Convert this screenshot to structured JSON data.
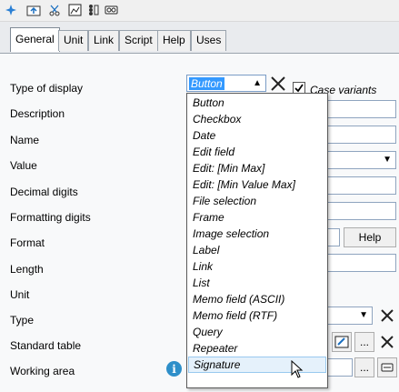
{
  "tabs": [
    "General",
    "Unit",
    "Link",
    "Script",
    "Help",
    "Uses"
  ],
  "labels": {
    "type_of_display": "Type of display",
    "description": "Description",
    "name": "Name",
    "value": "Value",
    "decimal_digits": "Decimal digits",
    "formatting_digits": "Formatting digits",
    "format": "Format",
    "length": "Length",
    "unit": "Unit",
    "type": "Type",
    "standard_table": "Standard table",
    "working_area": "Working area"
  },
  "type_of_display_value": "Button",
  "case_variants": {
    "label": "Case variants",
    "checked": true
  },
  "help_button": "Help",
  "ellipsis": "...",
  "info_glyph": "i",
  "display_options": [
    "Button",
    "Checkbox",
    "Date",
    "Edit field",
    "Edit: [Min Max]",
    "Edit: [Min Value Max]",
    "File selection",
    "Frame",
    "Image selection",
    "Label",
    "Link",
    "List",
    "Memo field (ASCII)",
    "Memo field (RTF)",
    "Query",
    "Repeater",
    "Signature"
  ],
  "hovered_option": "Signature",
  "icons": [
    "star-icon",
    "folder-upload-icon",
    "cut-icon",
    "image-edit-icon",
    "list-icon",
    "tape-icon",
    "close-icon",
    "dropdown-arrow-icon",
    "edit-icon",
    "info-icon",
    "mouse-cursor-icon"
  ]
}
